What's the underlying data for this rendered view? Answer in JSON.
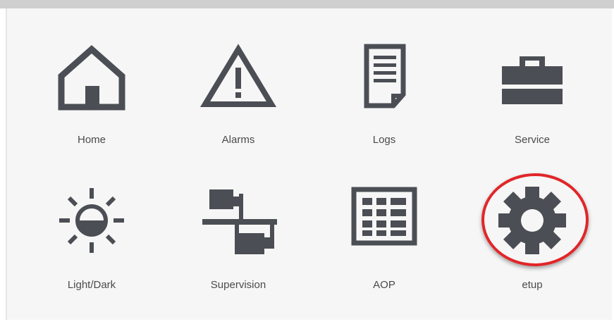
{
  "menu": {
    "items": [
      {
        "label": "Home",
        "icon": "home-icon"
      },
      {
        "label": "Alarms",
        "icon": "alarm-warning-icon"
      },
      {
        "label": "Logs",
        "icon": "document-icon"
      },
      {
        "label": "Service",
        "icon": "toolbox-icon"
      },
      {
        "label": "Light/Dark",
        "icon": "brightness-icon"
      },
      {
        "label": "Supervision",
        "icon": "supervision-network-icon"
      },
      {
        "label": "AOP",
        "icon": "grid-keypad-icon"
      },
      {
        "label": "etup",
        "icon": "gear-icon"
      }
    ]
  },
  "colors": {
    "icon": "#4b4e54",
    "label": "#4a4a4a",
    "highlight": "#e0262a",
    "panel": "#f6f6f6"
  }
}
